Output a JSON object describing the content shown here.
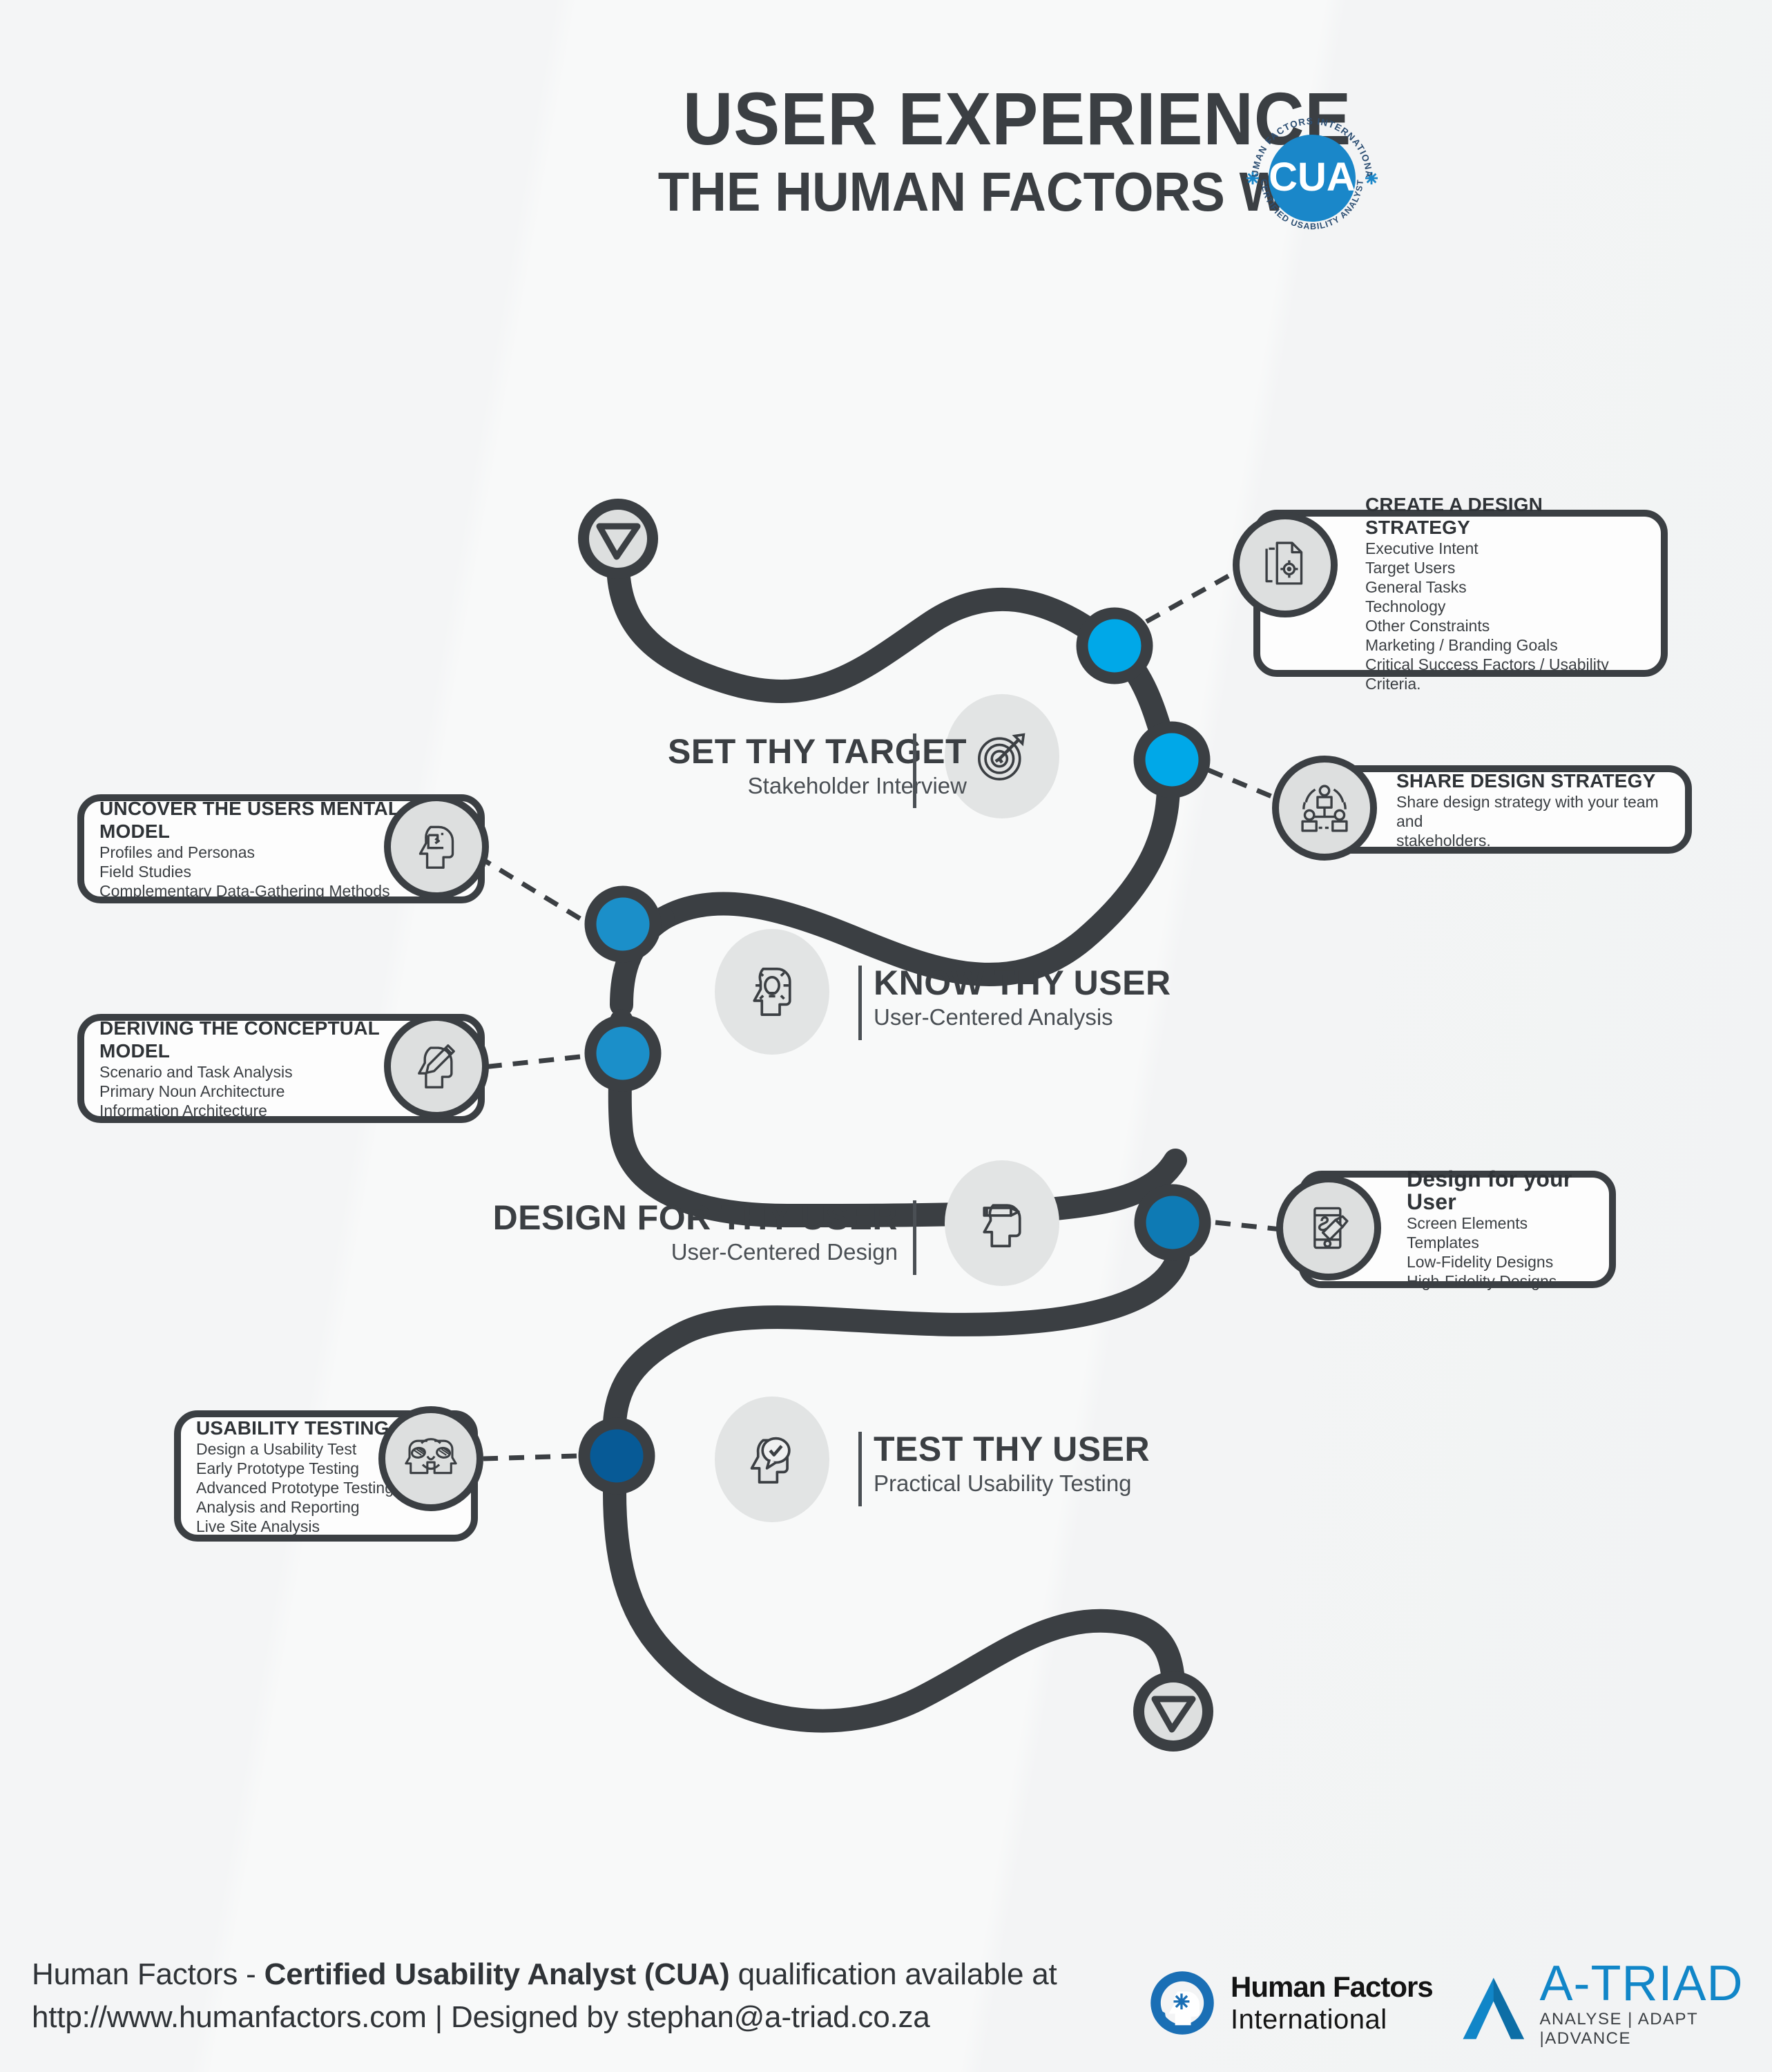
{
  "header": {
    "title_main": "USER EXPERIENCE",
    "title_sub": "THE HUMAN FACTORS WAY",
    "badge": {
      "center": "CUA",
      "arc_top": "HUMAN FACTORS INTERNATIONAL",
      "arc_bottom": "CERTIFIED USABILITY ANALYST",
      "color": "#1a87c9"
    }
  },
  "colors": {
    "dark": "#3b3f43",
    "node_cyan": "#00a8e8",
    "node_blue": "#1b8fc9",
    "node_steel": "#0e7ab4",
    "node_navy": "#075a96",
    "bubble_grey": "#e2e4e4",
    "badge_grey": "#dddfdf"
  },
  "stages": [
    {
      "id": "set-thy-target",
      "title": "SET THY TARGET",
      "subtitle": "Stakeholder Interview",
      "icon": "target-dartboard-icon"
    },
    {
      "id": "know-thy-user",
      "title": "KNOW THY USER",
      "subtitle": "User-Centered Analysis",
      "icon": "head-lightbulb-icon"
    },
    {
      "id": "design-for-thy-user",
      "title": "DESIGN FOR THY USER",
      "subtitle": "User-Centered Design",
      "icon": "head-pencil-icon"
    },
    {
      "id": "test-thy-user",
      "title": "TEST THY USER",
      "subtitle": "Practical Usability Testing",
      "icon": "head-check-speech-icon"
    }
  ],
  "callouts": [
    {
      "id": "create-a-design-strategy",
      "heading": "CREATE A DESIGN STRATEGY",
      "icon": "document-target-icon",
      "lines": [
        "Executive Intent",
        "Target Users",
        "General Tasks",
        "Technology",
        "Other Constraints",
        "Marketing / Branding Goals",
        "Critical Success Factors / Usability Criteria."
      ]
    },
    {
      "id": "share-design-strategy",
      "heading": "SHARE DESIGN STRATEGY",
      "icon": "people-network-icon",
      "lines": [
        "Share design strategy with your team and",
        "stakeholders."
      ]
    },
    {
      "id": "uncover-the-users-mental-model",
      "heading": "UNCOVER THE USERS MENTAL MODEL",
      "icon": "head-flowchart-icon",
      "lines": [
        "Profiles and Personas",
        "Field Studies",
        "Complementary Data-Gathering Methods"
      ]
    },
    {
      "id": "deriving-the-conceptual-model",
      "heading": "DERIVING THE CONCEPTUAL MODEL",
      "icon": "head-pencil-sketch-icon",
      "lines": [
        "Scenario and Task Analysis",
        "Primary Noun Architecture",
        "Information Architecture"
      ]
    },
    {
      "id": "design-for-your-user",
      "heading": "Design for your User",
      "icon": "phone-stylus-icon",
      "lines": [
        "Screen Elements",
        "Templates",
        "Low-Fidelity Designs",
        "High-Fidelity Designs"
      ]
    },
    {
      "id": "usability-testing",
      "heading": "USABILITY TESTING",
      "icon": "two-heads-testing-icon",
      "lines": [
        "Design a Usability Test",
        "Early Prototype Testing",
        "Advanced Prototype Testing",
        "Analysis and Reporting",
        "Live Site Analysis"
      ]
    }
  ],
  "footer": {
    "line1_pre": "Human Factors - ",
    "line1_bold": "Certified Usability Analyst (CUA)",
    "line1_post": " qualification available at",
    "line2": "http://www.humanfactors.com | Designed by stephan@a-triad.co.za",
    "hfi_logo": {
      "line1": "Human Factors",
      "line2": "International"
    },
    "atriad_logo": {
      "name": "A-TRIAD",
      "tagline": "ANALYSE | ADAPT |ADVANCE"
    }
  }
}
